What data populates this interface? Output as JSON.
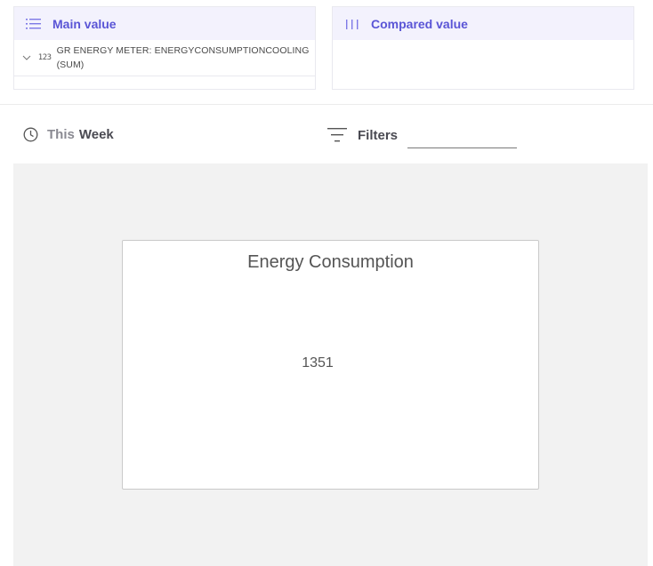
{
  "main_panel": {
    "title": "Main value",
    "icon": "list-icon",
    "field": {
      "type_badge": "123",
      "name": "GR ENERGY METER: ENERGYCONSUMPTIONCOOLING (SUM)"
    }
  },
  "compared_panel": {
    "title": "Compared value",
    "icon": "bars-icon"
  },
  "toolbar": {
    "time_prefix": "This",
    "time_unit": "Week",
    "filters_label": "Filters",
    "filters_value": ""
  },
  "widget": {
    "title": "Energy Consumption",
    "value": "1351"
  },
  "colors": {
    "accent": "#5a55d6",
    "header_bg": "#f3f2fd",
    "canvas_bg": "#f2f2f2"
  }
}
